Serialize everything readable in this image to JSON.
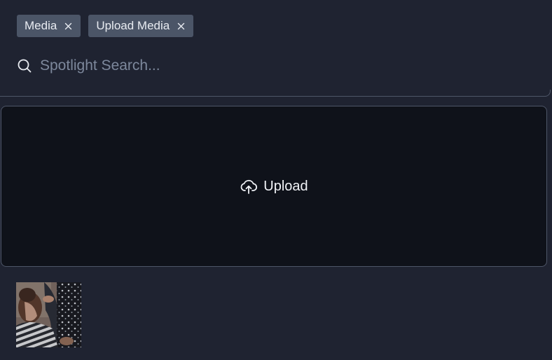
{
  "tags": [
    {
      "label": "Media",
      "remove_icon": "close-icon"
    },
    {
      "label": "Upload Media",
      "remove_icon": "close-icon"
    }
  ],
  "search": {
    "placeholder": "Spotlight Search...",
    "value": "",
    "icon": "search-icon"
  },
  "upload": {
    "label": "Upload",
    "icon": "cloud-upload-icon"
  },
  "media": {
    "items": [
      {
        "kind": "image-thumbnail"
      }
    ]
  },
  "colors": {
    "background": "#1f2331",
    "tag_bg": "#4b5567",
    "dropzone_bg": "#0f121a",
    "border": "#4e5668",
    "placeholder": "#7d889c"
  }
}
